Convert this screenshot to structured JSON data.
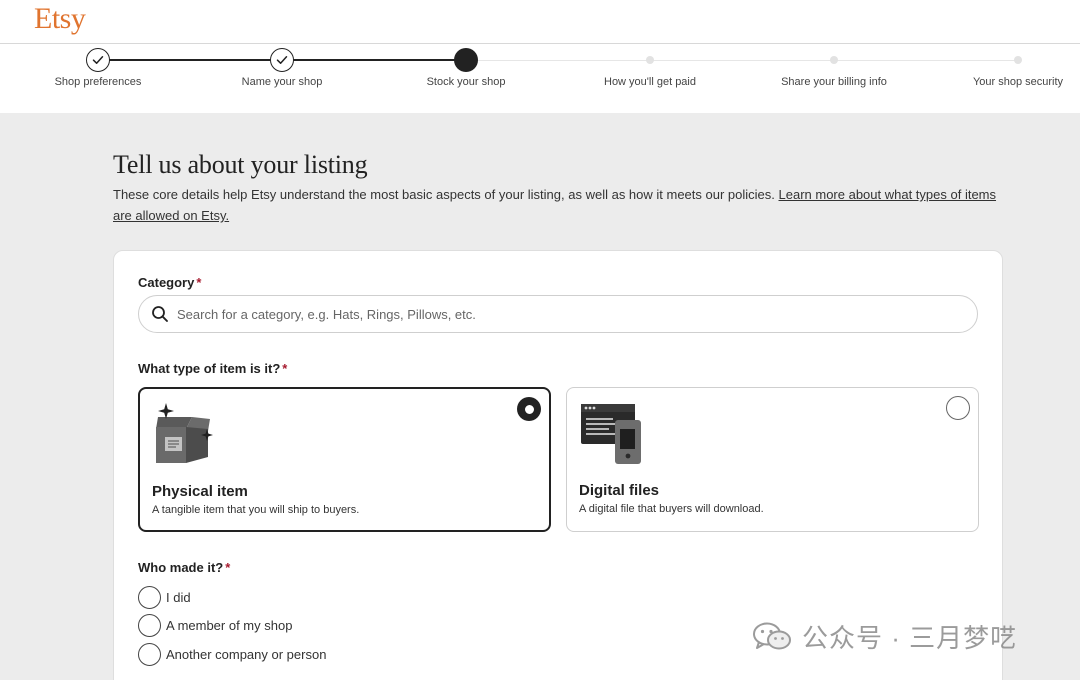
{
  "brand": {
    "logo_text": "Etsy",
    "accent_color": "#e0742f"
  },
  "stepper": {
    "steps": [
      {
        "label": "Shop preferences",
        "status": "done"
      },
      {
        "label": "Name your shop",
        "status": "done"
      },
      {
        "label": "Stock your shop",
        "status": "current"
      },
      {
        "label": "How you'll get paid",
        "status": "todo"
      },
      {
        "label": "Share your billing info",
        "status": "todo"
      },
      {
        "label": "Your shop security",
        "status": "todo"
      }
    ]
  },
  "intro": {
    "title": "Tell us about your listing",
    "text": "These core details help Etsy understand the most basic aspects of your listing, as well as how it meets our policies. ",
    "link_text": "Learn more about what types of items are allowed on Etsy."
  },
  "form": {
    "category": {
      "label": "Category",
      "required_mark": "*",
      "placeholder": "Search for a category, e.g. Hats, Rings, Pillows, etc.",
      "value": "",
      "icon": "search-icon"
    },
    "item_type": {
      "label": "What type of item is it?",
      "required_mark": "*",
      "options": [
        {
          "title": "Physical item",
          "description": "A tangible item that you will ship to buyers.",
          "selected": true,
          "icon": "box-sparkle-icon"
        },
        {
          "title": "Digital files",
          "description": "A digital file that buyers will download.",
          "selected": false,
          "icon": "digital-files-icon"
        }
      ]
    },
    "who_made": {
      "label": "Who made it?",
      "required_mark": "*",
      "options": [
        {
          "label": "I did",
          "selected": false
        },
        {
          "label": "A member of my shop",
          "selected": false
        },
        {
          "label": "Another company or person",
          "selected": false
        }
      ]
    }
  },
  "watermark": {
    "text": "公众号 · 三月梦呓",
    "icon": "wechat-icon"
  }
}
